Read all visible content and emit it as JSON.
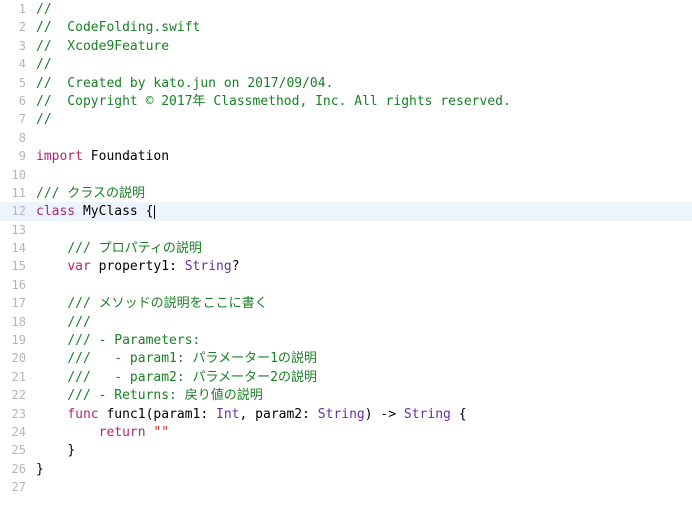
{
  "lines": [
    {
      "n": "1",
      "hl": false,
      "tokens": [
        [
          "comment",
          "//"
        ]
      ]
    },
    {
      "n": "2",
      "hl": false,
      "tokens": [
        [
          "comment",
          "//  CodeFolding.swift"
        ]
      ]
    },
    {
      "n": "3",
      "hl": false,
      "tokens": [
        [
          "comment",
          "//  Xcode9Feature"
        ]
      ]
    },
    {
      "n": "4",
      "hl": false,
      "tokens": [
        [
          "comment",
          "//"
        ]
      ]
    },
    {
      "n": "5",
      "hl": false,
      "tokens": [
        [
          "comment",
          "//  Created by kato.jun on 2017/09/04."
        ]
      ]
    },
    {
      "n": "6",
      "hl": false,
      "tokens": [
        [
          "comment",
          "//  Copyright © 2017年 Classmethod, Inc. All rights reserved."
        ]
      ]
    },
    {
      "n": "7",
      "hl": false,
      "tokens": [
        [
          "comment",
          "//"
        ]
      ]
    },
    {
      "n": "8",
      "hl": false,
      "tokens": []
    },
    {
      "n": "9",
      "hl": false,
      "tokens": [
        [
          "keyword",
          "import"
        ],
        [
          "ident",
          " Foundation"
        ]
      ]
    },
    {
      "n": "10",
      "hl": false,
      "tokens": []
    },
    {
      "n": "11",
      "hl": false,
      "tokens": [
        [
          "comment",
          "/// クラスの説明"
        ]
      ]
    },
    {
      "n": "12",
      "hl": true,
      "tokens": [
        [
          "keyword",
          "class"
        ],
        [
          "ident",
          " MyClass "
        ],
        [
          "punct",
          "{"
        ]
      ],
      "cursor": true
    },
    {
      "n": "13",
      "hl": false,
      "tokens": []
    },
    {
      "n": "14",
      "hl": false,
      "tokens": [
        [
          "ident",
          "    "
        ],
        [
          "comment",
          "/// プロパティの説明"
        ]
      ]
    },
    {
      "n": "15",
      "hl": false,
      "tokens": [
        [
          "ident",
          "    "
        ],
        [
          "keyword",
          "var"
        ],
        [
          "ident",
          " property1: "
        ],
        [
          "type",
          "String"
        ],
        [
          "punct",
          "?"
        ]
      ]
    },
    {
      "n": "16",
      "hl": false,
      "tokens": []
    },
    {
      "n": "17",
      "hl": false,
      "tokens": [
        [
          "ident",
          "    "
        ],
        [
          "comment",
          "/// メソッドの説明をここに書く"
        ]
      ]
    },
    {
      "n": "18",
      "hl": false,
      "tokens": [
        [
          "ident",
          "    "
        ],
        [
          "comment",
          "///"
        ]
      ]
    },
    {
      "n": "19",
      "hl": false,
      "tokens": [
        [
          "ident",
          "    "
        ],
        [
          "comment",
          "/// - Parameters:"
        ]
      ]
    },
    {
      "n": "20",
      "hl": false,
      "tokens": [
        [
          "ident",
          "    "
        ],
        [
          "comment",
          "///   - param1: パラメーター1の説明"
        ]
      ]
    },
    {
      "n": "21",
      "hl": false,
      "tokens": [
        [
          "ident",
          "    "
        ],
        [
          "comment",
          "///   - param2: パラメーター2の説明"
        ]
      ]
    },
    {
      "n": "22",
      "hl": false,
      "tokens": [
        [
          "ident",
          "    "
        ],
        [
          "comment",
          "/// - Returns: 戻り値の説明"
        ]
      ]
    },
    {
      "n": "23",
      "hl": false,
      "tokens": [
        [
          "ident",
          "    "
        ],
        [
          "keyword",
          "func"
        ],
        [
          "ident",
          " func1(param1: "
        ],
        [
          "type",
          "Int"
        ],
        [
          "ident",
          ", param2: "
        ],
        [
          "type",
          "String"
        ],
        [
          "ident",
          ") -> "
        ],
        [
          "type",
          "String"
        ],
        [
          "ident",
          " "
        ],
        [
          "punct",
          "{"
        ]
      ]
    },
    {
      "n": "24",
      "hl": false,
      "tokens": [
        [
          "ident",
          "        "
        ],
        [
          "keyword",
          "return"
        ],
        [
          "ident",
          " "
        ],
        [
          "string",
          "\"\""
        ]
      ]
    },
    {
      "n": "25",
      "hl": false,
      "tokens": [
        [
          "ident",
          "    "
        ],
        [
          "punct",
          "}"
        ]
      ]
    },
    {
      "n": "26",
      "hl": false,
      "tokens": [
        [
          "punct",
          "}"
        ]
      ]
    },
    {
      "n": "27",
      "hl": false,
      "tokens": []
    }
  ]
}
